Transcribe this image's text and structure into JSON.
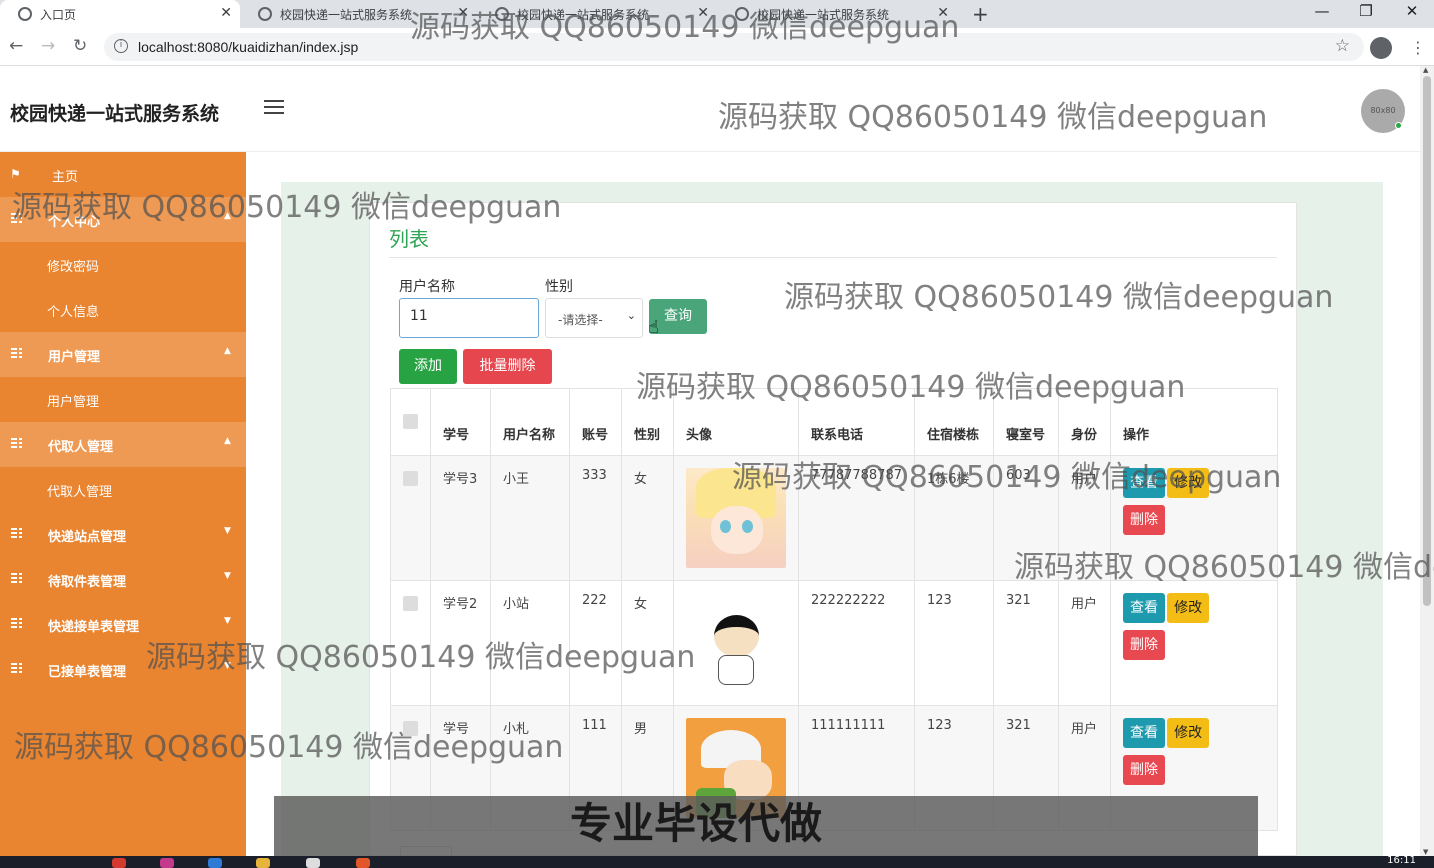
{
  "browser": {
    "tabs": [
      {
        "title": "入口页",
        "active": true
      },
      {
        "title": "校园快递一站式服务系统",
        "active": false
      },
      {
        "title": "校园快递一站式服务系统",
        "active": false
      },
      {
        "title": "校园快递一站式服务系统",
        "active": false
      }
    ],
    "url": "localhost:8080/kuaidizhan/index.jsp"
  },
  "header": {
    "brand": "校园快递一站式服务系统",
    "avatar_text": "80x80"
  },
  "sidebar": {
    "items": [
      {
        "label": "主页",
        "type": "home"
      },
      {
        "label": "个人中心",
        "type": "group"
      },
      {
        "label": "修改密码",
        "type": "sub"
      },
      {
        "label": "个人信息",
        "type": "sub"
      },
      {
        "label": "用户管理",
        "type": "group"
      },
      {
        "label": "用户管理",
        "type": "sub"
      },
      {
        "label": "代取人管理",
        "type": "group"
      },
      {
        "label": "代取人管理",
        "type": "sub"
      },
      {
        "label": "快递站点管理",
        "type": "collapsed"
      },
      {
        "label": "待取件表管理",
        "type": "collapsed"
      },
      {
        "label": "快递接单表管理",
        "type": "collapsed"
      },
      {
        "label": "已接单表管理",
        "type": "collapsed"
      }
    ]
  },
  "panel": {
    "title": "列表",
    "search": {
      "name_label": "用户名称",
      "name_value": "11",
      "gender_label": "性别",
      "gender_selected": "-请选择-",
      "query_button": "查询"
    },
    "add_button": "添加",
    "batch_delete_button": "批量删除",
    "table": {
      "headers": [
        "学号",
        "用户名称",
        "账号",
        "性别",
        "头像",
        "联系电话",
        "住宿楼栋",
        "寝室号",
        "身份",
        "操作"
      ],
      "rows": [
        {
          "xuehao": "学号3",
          "name": "小王",
          "account": "333",
          "gender": "女",
          "phone": "77787788787",
          "building": "1栋6楼",
          "room": "603",
          "role": "用户"
        },
        {
          "xuehao": "学号2",
          "name": "小站",
          "account": "222",
          "gender": "女",
          "phone": "222222222",
          "building": "123",
          "room": "321",
          "role": "用户"
        },
        {
          "xuehao": "学号",
          "name": "小札",
          "account": "111",
          "gender": "男",
          "phone": "111111111",
          "building": "123",
          "room": "321",
          "role": "用户"
        }
      ],
      "actions": {
        "view": "查看",
        "edit": "修改",
        "delete": "删除"
      }
    }
  },
  "watermark": "源码获取 QQ86050149 微信deepguan",
  "overlay_banner": "专业毕设代做",
  "taskbar": {
    "clock": "16:11"
  }
}
